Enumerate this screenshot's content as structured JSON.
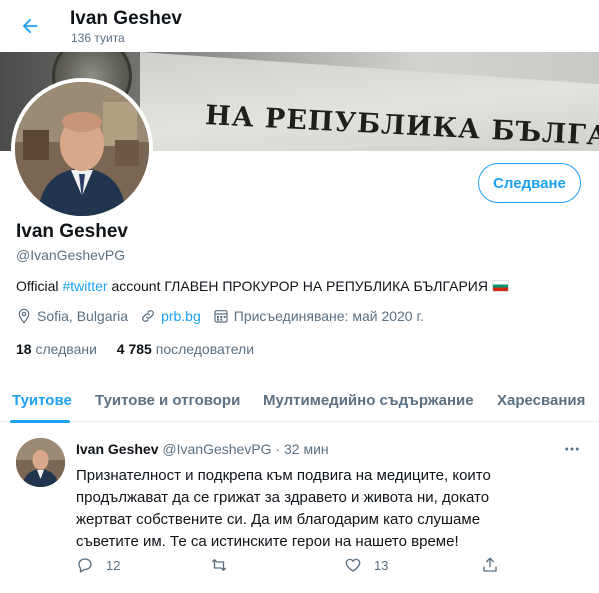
{
  "header": {
    "name": "Ivan Geshev",
    "tweet_count": "136 туита"
  },
  "banner": {
    "text": "НА РЕПУБЛИКА БЪЛГАРИЯ"
  },
  "profile": {
    "name": "Ivan Geshev",
    "handle": "@IvanGeshevPG",
    "follow_label": "Следване",
    "bio_prefix": "Official ",
    "bio_hashtag": "#twitter",
    "bio_suffix": " account ГЛАВЕН ПРОКУРОР НА РЕПУБЛИКА БЪЛГАРИЯ",
    "location": "Sofia, Bulgaria",
    "website": "prb.bg",
    "joined": "Присъединяване: май 2020 г.",
    "following_count": "18",
    "following_label": "следвани",
    "followers_count": "4 785",
    "followers_label": "последователи"
  },
  "tabs": [
    {
      "label": "Туитове",
      "active": true
    },
    {
      "label": "Туитове и отговори",
      "active": false
    },
    {
      "label": "Мултимедийно съдържание",
      "active": false
    },
    {
      "label": "Харесвания",
      "active": false
    }
  ],
  "tweet": {
    "name": "Ivan Geshev",
    "handle": "@IvanGeshevPG",
    "separator": " · ",
    "time": "32 мин",
    "text": "Признателност и подкрепа към подвига на медиците, които продължават да се грижат за здравето и живота ни, докато жертват собствените си. Да им благодарим като слушаме съветите им. Те са истинските герои на нашето време!",
    "reply_count": "12",
    "retweet_count": "",
    "like_count": "13"
  },
  "colors": {
    "accent": "#1da1f2",
    "secondary_text": "#5b7083",
    "primary_text": "#0f1419"
  },
  "icons": [
    "back-arrow-icon",
    "location-icon",
    "link-icon",
    "calendar-icon",
    "more-icon",
    "reply-icon",
    "retweet-icon",
    "like-icon",
    "share-icon"
  ]
}
